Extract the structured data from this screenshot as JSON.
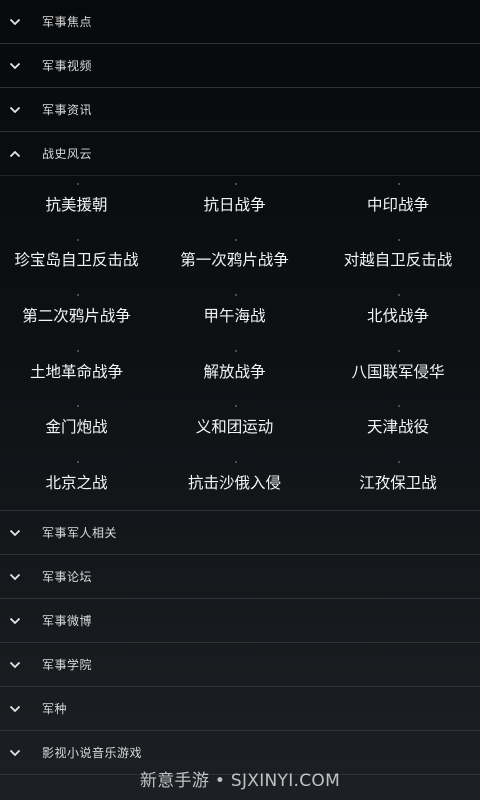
{
  "sections_top": [
    {
      "label": "军事焦点"
    },
    {
      "label": "军事视频"
    },
    {
      "label": "军事资讯"
    }
  ],
  "expanded_section": {
    "label": "战史风云",
    "items": [
      "抗美援朝",
      "抗日战争",
      "中印战争",
      "珍宝岛自卫反击战",
      "第一次鸦片战争",
      "对越自卫反击战",
      "第二次鸦片战争",
      "甲午海战",
      "北伐战争",
      "土地革命战争",
      "解放战争",
      "八国联军侵华",
      "金门炮战",
      "义和团运动",
      "天津战役",
      "北京之战",
      "抗击沙俄入侵",
      "江孜保卫战"
    ]
  },
  "sections_bottom": [
    {
      "label": "军事军人相关"
    },
    {
      "label": "军事论坛"
    },
    {
      "label": "军事微博"
    },
    {
      "label": "军事学院"
    },
    {
      "label": "军种"
    },
    {
      "label": "影视小说音乐游戏"
    }
  ],
  "watermark": "新意手游 • SJXINYI.COM",
  "icons": {
    "collapsed": "chevron-down-icon",
    "expanded": "chevron-up-icon"
  }
}
